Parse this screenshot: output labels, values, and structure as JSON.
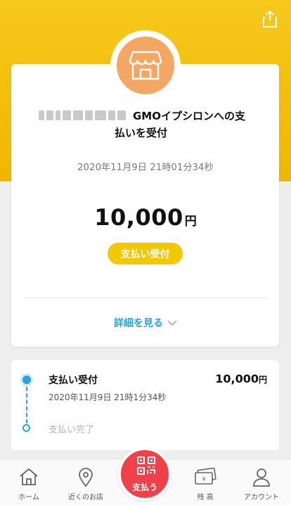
{
  "header": {
    "share_icon": "share-icon",
    "accent_color": "#f4c800"
  },
  "transaction": {
    "store_icon": "store-icon",
    "merchant_name_line1": "GMOイプシロンへの支",
    "merchant_name_line2": "払いを受付",
    "datetime": "2020年11月9日 21時01分34秒",
    "amount": "10,000",
    "currency": "円",
    "status": "支払い受付",
    "details_link": "詳細を見る"
  },
  "timeline": {
    "steps": [
      {
        "title": "支払い受付",
        "time": "2020年11月9日 21時1分34秒",
        "amount": "10,000",
        "currency": "円",
        "active": true
      },
      {
        "title": "支払い完了",
        "active": false
      }
    ],
    "color": "#2ba3dc"
  },
  "tabbar": {
    "tabs": [
      {
        "label": "ホーム",
        "icon": "home-icon"
      },
      {
        "label": "近くのお店",
        "icon": "map-pin-icon"
      },
      {
        "label": "支払う",
        "icon": "qr-code-icon"
      },
      {
        "label": "残 高",
        "icon": "balance-icon"
      },
      {
        "label": "アカウント",
        "icon": "account-icon"
      }
    ],
    "pay_color": "#f0404a"
  }
}
